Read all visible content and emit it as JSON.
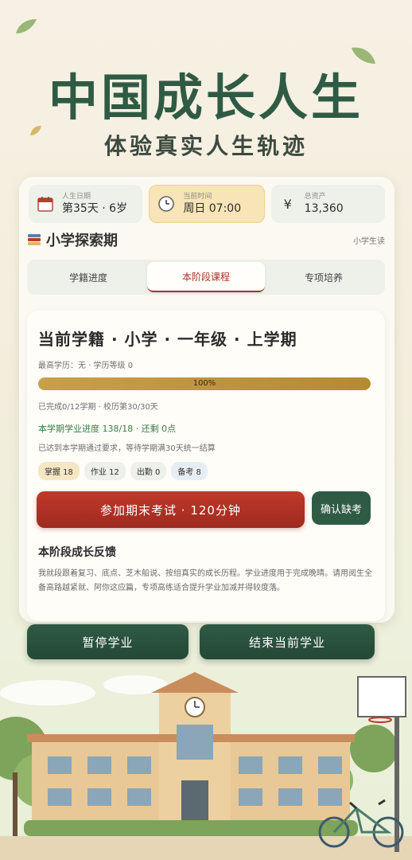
{
  "hero": {
    "title": "中国成长人生",
    "subtitle": "体验真实人生轨迹"
  },
  "stats": [
    {
      "label": "人生日期",
      "value": "第35天 · 6岁",
      "icon": "calendar-icon"
    },
    {
      "label": "当前时间",
      "value": "周日 07:00",
      "icon": "clock-icon"
    },
    {
      "label": "总资产",
      "value": "13,360",
      "icon": "yen-icon"
    }
  ],
  "section": {
    "title": "小学探索期",
    "tag": "小学生读"
  },
  "tabs": [
    "学籍进度",
    "本阶段课程",
    "专项培养"
  ],
  "active_tab": "本阶段课程",
  "enrollment": {
    "title": "当前学籍 · 小学 · 一年级 · 上学期",
    "education": "最高学历：无 · 学历等级 0",
    "progress_label": "100%",
    "progress": 1.0,
    "completed": "已完成0/12学期 · 校历第30/30天",
    "study_progress": "本学期学业进度 138/18 · 还剩 0点",
    "reached": "已达到本学期通过要求，等待学期满30天统一结算"
  },
  "chips": [
    "掌握 18",
    "作业 12",
    "出勤 0",
    "备考 8"
  ],
  "actions": {
    "exam": "参加期末考试 · 120分钟",
    "absent": "确认缺考"
  },
  "feedback": {
    "title": "本阶段成长反馈",
    "text": "我就段跟着复习、底点、芝木船说、按组真实的成长历程。学业进度用于完成晚晴。请用阅生全备高路越紧就、阿你这应篇，专项高练适合提升学业加减并得较度落。"
  },
  "bottom": {
    "pause": "暂停学业",
    "end": "结束当前学业"
  },
  "colors": {
    "accent_green": "#2f5b45",
    "accent_red": "#b5342a",
    "gold": "#c7a04a"
  }
}
